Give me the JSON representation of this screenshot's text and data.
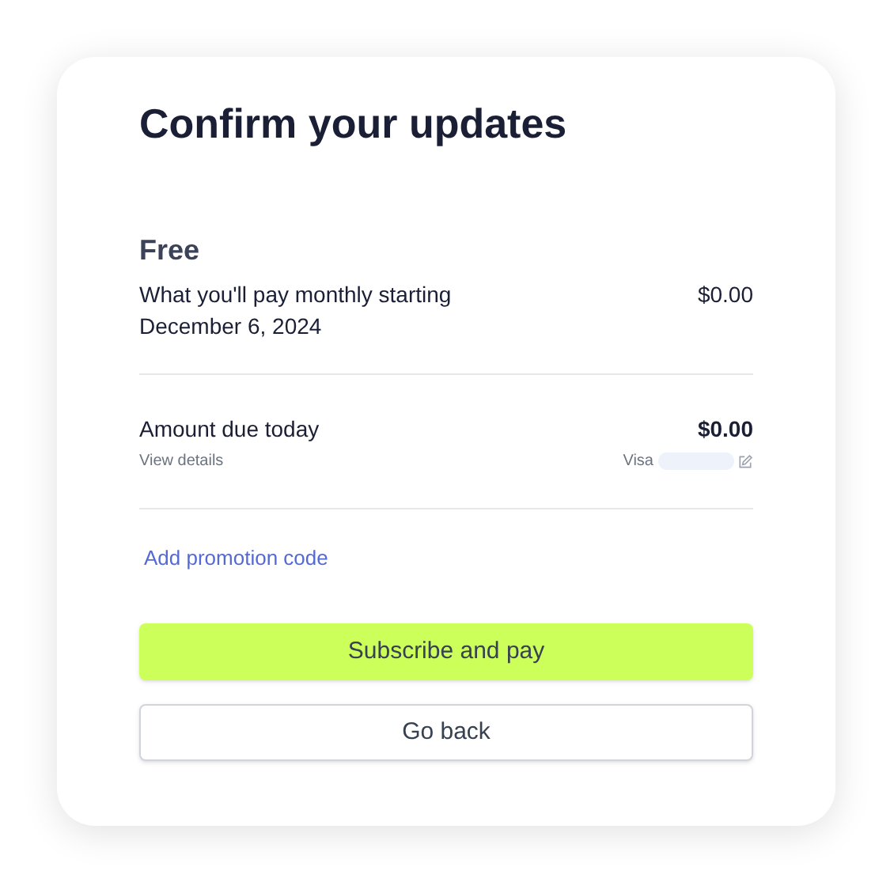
{
  "title": "Confirm your updates",
  "plan": {
    "name": "Free",
    "description": "What you'll pay monthly starting December 6, 2024",
    "price": "$0.00"
  },
  "due": {
    "label": "Amount due today",
    "amount": "$0.00",
    "details_link": "View details",
    "card_brand": "Visa"
  },
  "promotion_link": "Add promotion code",
  "buttons": [
    {
      "kind": "primary",
      "label": "Subscribe and pay"
    },
    {
      "kind": "secondary",
      "label": "Go back"
    }
  ]
}
